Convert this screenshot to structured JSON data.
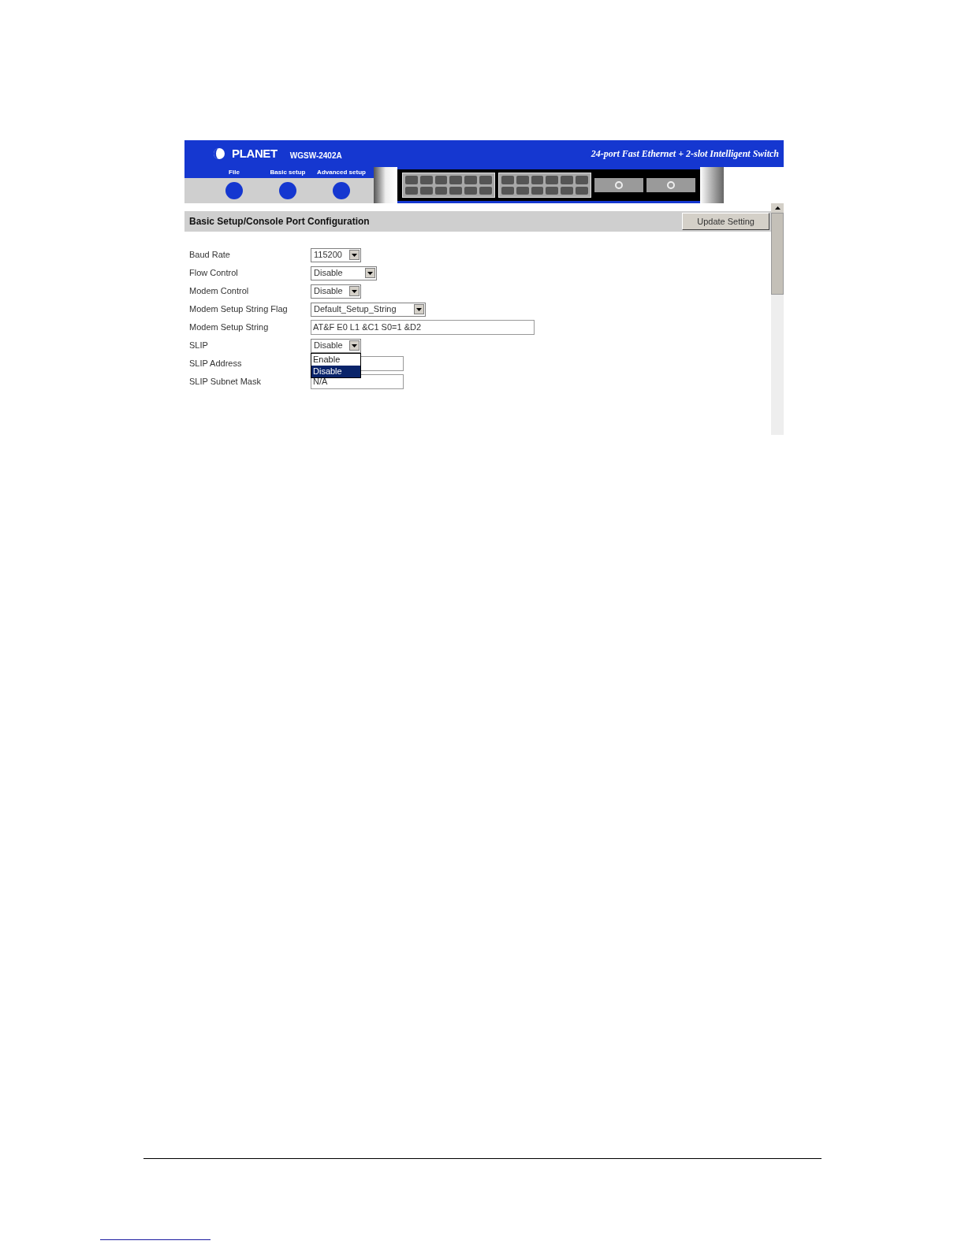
{
  "header": {
    "logo": "PLANET",
    "model": "WGSW-2402A",
    "title": "24-port Fast Ethernet + 2-slot Intelligent Switch"
  },
  "nav": [
    {
      "label": "File"
    },
    {
      "label": "Basic setup"
    },
    {
      "label": "Advanced setup"
    }
  ],
  "section": {
    "title": "Basic Setup/Console Port Configuration",
    "button": "Update Setting"
  },
  "fields": [
    {
      "label": "Baud Rate",
      "kind": "select",
      "value": "115200"
    },
    {
      "label": "Flow Control",
      "kind": "select",
      "value": "Disable"
    },
    {
      "label": "Modem Control",
      "kind": "select",
      "value": "Disable"
    },
    {
      "label": "Modem Setup String Flag",
      "kind": "select",
      "value": "Default_Setup_String"
    },
    {
      "label": "Modem Setup String",
      "kind": "text",
      "value": "AT&F E0 L1 &C1 S0=1 &D2"
    },
    {
      "label": "SLIP",
      "kind": "select",
      "value": "Disable",
      "expanded": true,
      "options": [
        {
          "label": "Enable",
          "selected": false
        },
        {
          "label": "Disable",
          "selected": true
        }
      ]
    },
    {
      "label": "SLIP Address",
      "kind": "text"
    },
    {
      "label": "SLIP Subnet Mask",
      "kind": "text",
      "value": "N/A"
    }
  ]
}
